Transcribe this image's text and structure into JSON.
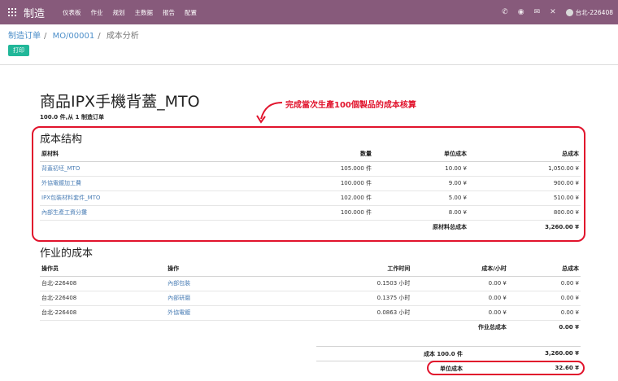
{
  "navbar": {
    "brand": "制造",
    "menu": [
      "仪表板",
      "作业",
      "规划",
      "主数据",
      "报告",
      "配置"
    ],
    "user": "台北-226408",
    "icons": [
      "phone-icon",
      "activity-icon",
      "chat-icon",
      "close-icon"
    ]
  },
  "breadcrumb": {
    "item1": "制造订单",
    "item2": "MO/00001",
    "current": "成本分析"
  },
  "buttons": {
    "print": "打印"
  },
  "report": {
    "product": "商品IPX手機背蓋_MTO",
    "subtitle": "100.0 件,从 1 制造订单",
    "annotation": "完成當次生產100個製品的成本核算",
    "cost_structure": {
      "title": "成本结构",
      "headers": [
        "原材料",
        "数量",
        "单位成本",
        "总成本"
      ],
      "rows": [
        {
          "name": "背蓋初坯_MTO",
          "qty": "105.000 件",
          "unit": "10.00 ¥",
          "total": "1,050.00 ¥"
        },
        {
          "name": "外協電鍍加工費",
          "qty": "100.000 件",
          "unit": "9.00 ¥",
          "total": "900.00 ¥"
        },
        {
          "name": "IPX包裝材料套件_MTO",
          "qty": "102.000 件",
          "unit": "5.00 ¥",
          "total": "510.00 ¥"
        },
        {
          "name": "內部生產工資分攤",
          "qty": "100.000 件",
          "unit": "8.00 ¥",
          "total": "800.00 ¥"
        }
      ],
      "total_label": "原材料总成本",
      "total_value": "3,260.00 ¥"
    },
    "operations": {
      "title": "作业的成本",
      "headers": [
        "操作员",
        "操作",
        "工作时间",
        "成本/小时",
        "总成本"
      ],
      "rows": [
        {
          "operator": "台北-226408",
          "op": "內部包裝",
          "time": "0.1503 小时",
          "rate": "0.00 ¥",
          "total": "0.00 ¥"
        },
        {
          "operator": "台北-226408",
          "op": "內部研磨",
          "time": "0.1375 小时",
          "rate": "0.00 ¥",
          "total": "0.00 ¥"
        },
        {
          "operator": "台北-226408",
          "op": "外協電鍍",
          "time": "0.0863 小时",
          "rate": "0.00 ¥",
          "total": "0.00 ¥"
        }
      ],
      "total_label": "作业总成本",
      "total_value": "0.00 ¥"
    },
    "summary": {
      "cost_label": "成本 100.0 件",
      "cost_value": "3,260.00 ¥",
      "unit_label": "单位成本",
      "unit_value": "32.60 ¥"
    }
  },
  "colors": {
    "navbar": "#875a7b",
    "print_button": "#21b799",
    "annotation_red": "#e1132c",
    "link": "#4c7fb6"
  }
}
